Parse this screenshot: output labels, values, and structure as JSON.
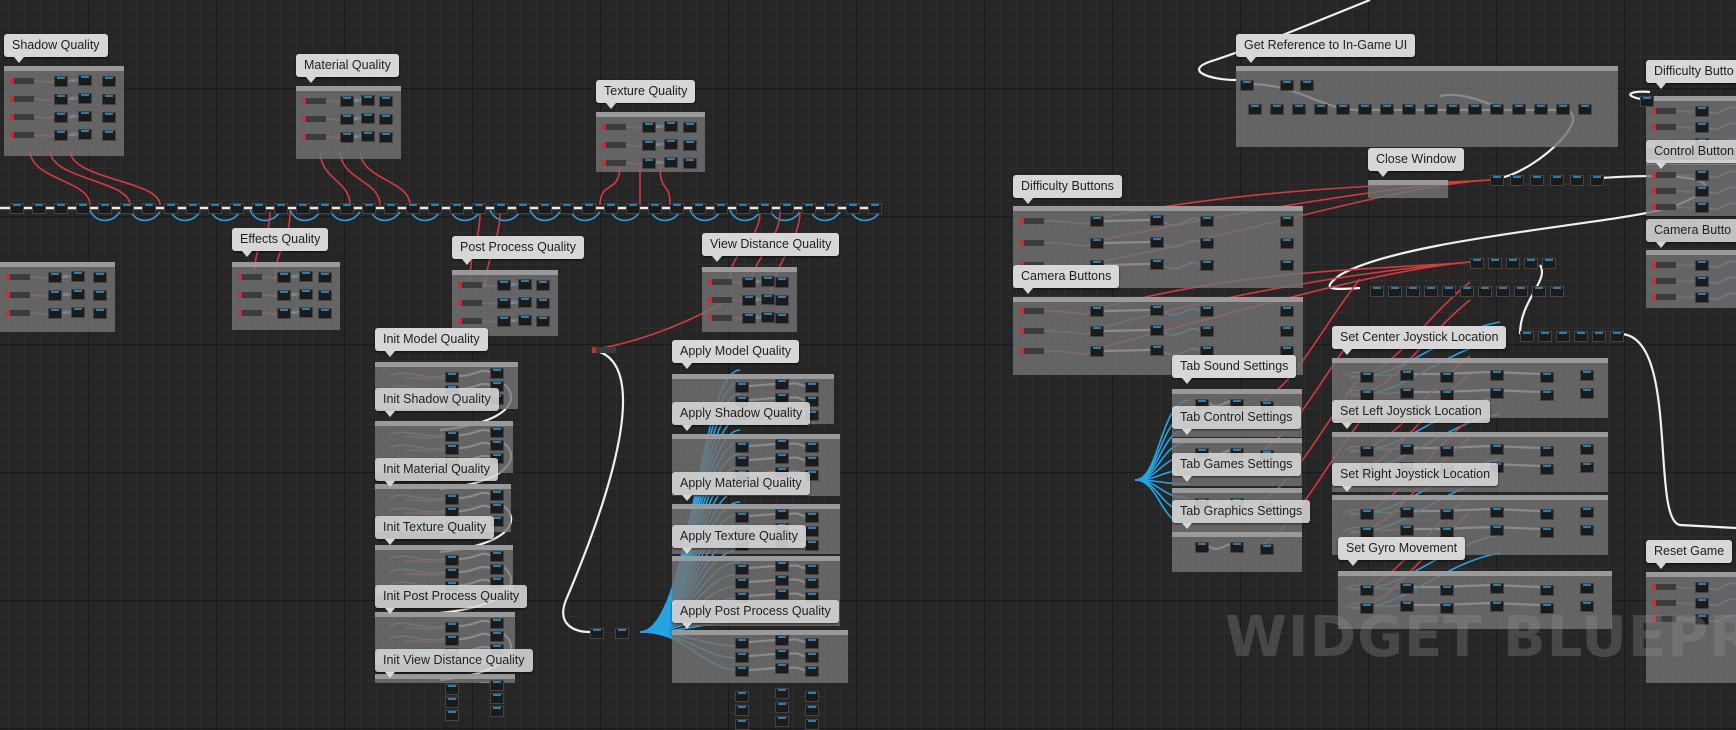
{
  "graph": {
    "watermark": "WIDGET BLUEPRINT",
    "comments": [
      "Shadow Quality",
      "Material Quality",
      "Texture Quality",
      "Effects Quality",
      "Post Process Quality",
      "View Distance Quality",
      "Init Model Quality",
      "Init Shadow Quality",
      "Init Material Quality",
      "Init Texture Quality",
      "Init Post Process Quality",
      "Init View Distance Quality",
      "Apply Model Quality",
      "Apply Shadow Quality",
      "Apply Material Quality",
      "Apply Texture Quality",
      "Apply Post Process Quality",
      "Get Reference to In-Game UI",
      "Close Window",
      "Difficulty Buttons",
      "Camera Buttons",
      "Tab Sound Settings",
      "Tab Control Settings",
      "Tab Games Settings",
      "Tab Graphics Settings",
      "Set Center Joystick Location",
      "Set Left Joystick Location",
      "Set Right Joystick Location",
      "Set Gyro Movement",
      "Difficulty Butto",
      "Control Button",
      "Camera Butto",
      "Reset Game"
    ]
  },
  "colors": {
    "background": "#262626",
    "exec_wire": "#e8e8e8",
    "object_wire": "#d9383f",
    "data_wire": "#25a4e6",
    "struct_wire": "#3aa07a",
    "comment_bubble": "#d7d7d7"
  }
}
